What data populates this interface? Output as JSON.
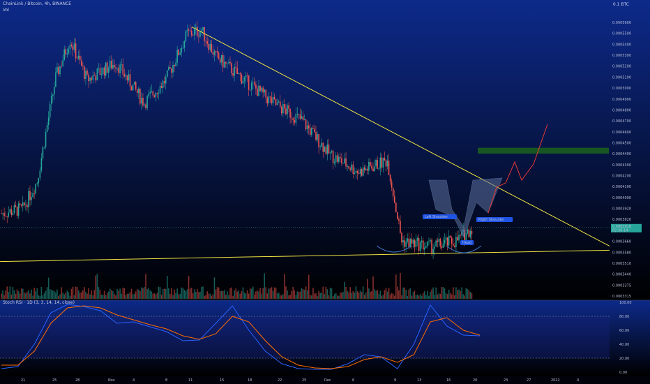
{
  "header": {
    "symbol_line": "ChainLink / Bitcoin, 4h, BINANCE",
    "volume_label": "Vol",
    "currency_label": "0.1 BTC",
    "stoch_label": "Stoch RSI · 1D (3, 3, 14, 14, close)"
  },
  "colors": {
    "bg_top": "#0d2a8a",
    "bg_bottom": "#000000",
    "up": "#26a69a",
    "down": "#ef5350",
    "trendline": "#f0e442",
    "target_zone": "#1b5e20",
    "projection": "#e53935",
    "k_line": "#2962ff",
    "d_line": "#ff6d00"
  },
  "chart_data": [
    {
      "type": "candlestick",
      "title": "ChainLink / Bitcoin, 4h, BINANCE",
      "price_ticks": [
        "0.0005600",
        "0.0005500",
        "0.0005400",
        "0.0005300",
        "0.0005200",
        "0.0005100",
        "0.0005000",
        "0.0004900",
        "0.0004800",
        "0.0004700",
        "0.0004600",
        "0.0004500",
        "0.0004400",
        "0.0004300",
        "0.0004200",
        "0.0004100",
        "0.0004000",
        "0.0003920",
        "0.0003820",
        "0.0003740",
        "0.0003660",
        "0.0003580",
        "0.0003510",
        "0.0003440",
        "0.0003375",
        "0.0003315"
      ],
      "time_ticks": [
        "21",
        "25",
        "28",
        "Nov",
        "4",
        "8",
        "11",
        "15",
        "18",
        "22",
        "25",
        "Dec",
        "6",
        "9",
        "13",
        "16",
        "20",
        "23",
        "27",
        "2022",
        "4"
      ],
      "current_price": "0.0003918",
      "countdown": "02:36:14",
      "ylim": [
        0.000331,
        0.00057
      ],
      "ohlc_summary": {
        "start": 0.000404,
        "max": 0.000563,
        "min": 0.000369,
        "end": 0.0003918
      },
      "annotations": [
        "Left Shoulder",
        "Head",
        "Right Shoulder"
      ],
      "drawings": {
        "descending_trendline": [
          [
            0.000566,
            "Nov 11"
          ],
          [
            0.000372,
            "Jan 4"
          ]
        ],
        "support_line": 0.000367,
        "target_zone": [
          0.000461,
          0.000456
        ],
        "pattern": "inverse head and shoulders"
      }
    },
    {
      "type": "line",
      "title": "Stoch RSI · 1D (3, 3, 14, 14, close)",
      "ylim": [
        0,
        100
      ],
      "ticks": [
        "100.00",
        "80.00",
        "60.00",
        "40.00",
        "20.00",
        "0.00"
      ],
      "bands": [
        20,
        80
      ],
      "series": [
        {
          "name": "K",
          "values": [
            5,
            8,
            40,
            85,
            97,
            94,
            88,
            70,
            72,
            65,
            58,
            45,
            46,
            70,
            95,
            60,
            30,
            12,
            5,
            4,
            4,
            12,
            25,
            22,
            5,
            40,
            96,
            66,
            53,
            52
          ]
        },
        {
          "name": "D",
          "values": [
            10,
            10,
            30,
            70,
            92,
            95,
            92,
            82,
            75,
            68,
            62,
            52,
            47,
            55,
            80,
            72,
            45,
            22,
            10,
            6,
            5,
            8,
            18,
            22,
            14,
            25,
            72,
            78,
            60,
            53
          ]
        }
      ]
    }
  ]
}
